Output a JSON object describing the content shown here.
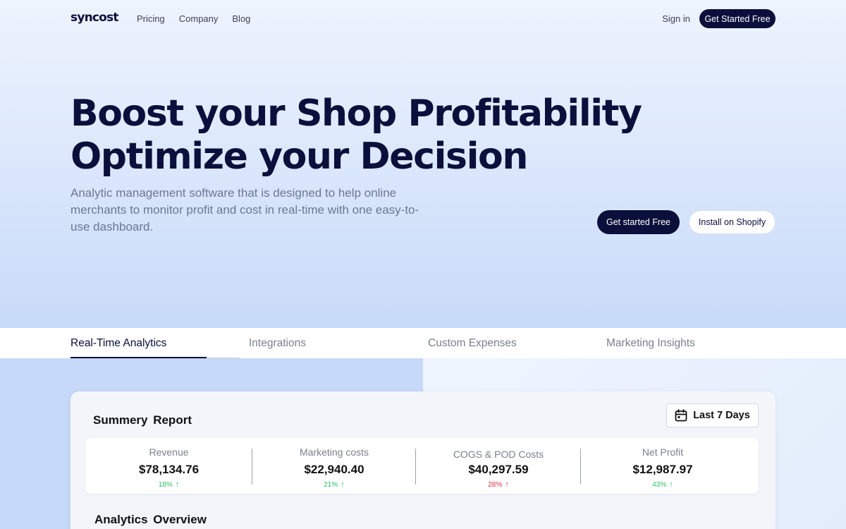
{
  "nav": {
    "logo": "syncost",
    "links": [
      "Pricing",
      "Company",
      "Blog"
    ],
    "signin": "Sign in",
    "cta": "Get Started Free"
  },
  "hero": {
    "title_line1": "Boost your Shop Profitability",
    "title_line2": "Optimize your Decision",
    "subtitle": "Analytic management software that is designed to help online merchants to monitor profit and cost in real-time with one easy-to-use dashboard.",
    "primary_button": "Get started Free",
    "secondary_button": "Install on Shopify"
  },
  "tabs": [
    {
      "label": "Real-Time Analytics",
      "active": true
    },
    {
      "label": "Integrations",
      "active": false
    },
    {
      "label": "Custom Expenses",
      "active": false
    },
    {
      "label": "Marketing Insights",
      "active": false
    }
  ],
  "report": {
    "title": "Summery Report",
    "date_range": "Last 7 Days",
    "stats": [
      {
        "label": "Revenue",
        "value": "$78,134.76",
        "change": "18%",
        "direction": "up",
        "color": "#2bbf6a"
      },
      {
        "label": "Marketing costs",
        "value": "$22,940.40",
        "change": "21%",
        "direction": "up",
        "color": "#2bbf6a"
      },
      {
        "label": "COGS & POD Costs",
        "value": "$40,297.59",
        "change": "28%",
        "direction": "up",
        "color": "#d9304a"
      },
      {
        "label": "Net Profit",
        "value": "$12,987.97",
        "change": "43%",
        "direction": "up",
        "color": "#2bbf6a"
      }
    ],
    "overview_title": "Analytics Overview"
  },
  "colors": {
    "brand_navy": "#0b0f3b",
    "positive": "#2bbf6a",
    "negative": "#d9304a"
  }
}
